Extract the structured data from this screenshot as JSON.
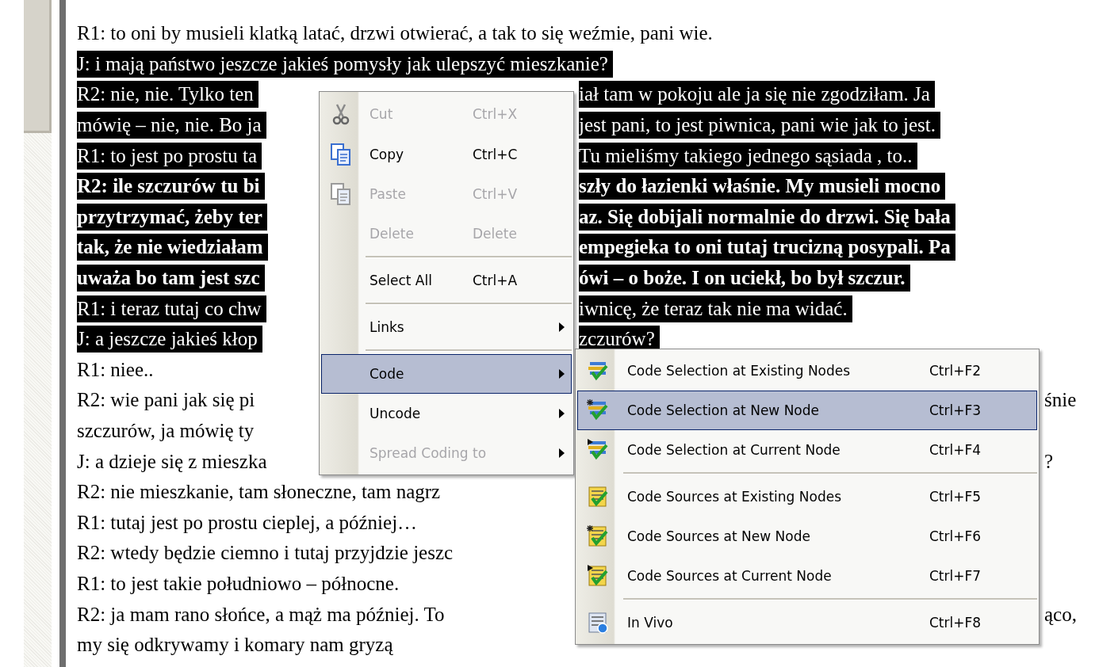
{
  "document": {
    "lines": [
      {
        "left": "R1: to oni by musieli klatką latać, drzwi otwierać, a tak to się weźmie, pani wie.",
        "selected": false,
        "bold": false
      },
      {
        "left": "J: i mają państwo jeszcze jakieś pomysły jak ulepszyć mieszkanie?",
        "selected": true,
        "bold": false
      },
      {
        "left": "R2: nie, nie. Tylko ten",
        "right": "iał tam w pokoju ale ja się nie zgodziłam. Ja",
        "selected": true,
        "bold": false
      },
      {
        "left": "mówię – nie, nie. Bo ja",
        "right": "jest pani, to jest piwnica, pani wie jak to jest.",
        "selected": true,
        "bold": false
      },
      {
        "left": "R1: to jest po prostu ta",
        "right": "Tu mieliśmy takiego jednego sąsiada , to..",
        "selected": true,
        "bold": false
      },
      {
        "left": "R2: ile szczurów tu bi",
        "right": "szły do łazienki właśnie. My musieli mocno",
        "selected": true,
        "bold": true
      },
      {
        "left": "przytrzymać, żeby ter",
        "right": "az. Się dobijali normalnie do drzwi. Się bała",
        "selected": true,
        "bold": true
      },
      {
        "left": "tak, że nie wiedziałam",
        "right": "empegieka to oni tutaj trucizną posypali. Pa",
        "selected": true,
        "bold": true
      },
      {
        "left": "uważa bo tam jest szc",
        "right": "ówi – o boże. I on uciekł, bo był szczur.",
        "selected": true,
        "bold": true
      },
      {
        "left": "R1: i teraz tutaj co chw",
        "right": "iwnicę, że teraz tak nie ma widać.",
        "selected": true,
        "bold": false
      },
      {
        "left": "J: a jeszcze jakieś kłop",
        "right": "zczurów?",
        "selected": true,
        "bold": false
      },
      {
        "left": "R1: niee..",
        "selected": false,
        "bold": false
      },
      {
        "left": "R2: wie pani jak się pi",
        "right": "śnie",
        "selected": false,
        "bold": false
      },
      {
        "left": "szczurów, ja mówię ty",
        "selected": false,
        "bold": false
      },
      {
        "left": "J: a dzieje się z mieszka",
        "right": "?",
        "selected": false,
        "bold": false
      },
      {
        "left": "R2: nie mieszkanie, tam słoneczne, tam nagrz",
        "selected": false,
        "bold": false
      },
      {
        "left": "R1: tutaj jest po prostu cieplej, a później…",
        "selected": false,
        "bold": false
      },
      {
        "left": "R2: wtedy będzie ciemno i tutaj przyjdzie jeszc",
        "selected": false,
        "bold": false
      },
      {
        "left": "R1: to jest takie południowo – północne.",
        "selected": false,
        "bold": false
      },
      {
        "left": "R2: ja mam rano słońce, a mąż ma później. To",
        "right": "ąco,",
        "selected": false,
        "bold": false
      },
      {
        "left": "my się odkrywamy i komary nam gryzą",
        "selected": false,
        "bold": false
      }
    ]
  },
  "context_menu": {
    "items": [
      {
        "kind": "item",
        "label": "Cut",
        "shortcut": "Ctrl+X",
        "disabled": true,
        "selected": false,
        "submenu": false
      },
      {
        "kind": "item",
        "label": "Copy",
        "shortcut": "Ctrl+C",
        "disabled": false,
        "selected": false,
        "submenu": false
      },
      {
        "kind": "item",
        "label": "Paste",
        "shortcut": "Ctrl+V",
        "disabled": true,
        "selected": false,
        "submenu": false
      },
      {
        "kind": "item",
        "label": "Delete",
        "shortcut": "Delete",
        "disabled": true,
        "selected": false,
        "submenu": false
      },
      {
        "kind": "separator"
      },
      {
        "kind": "item",
        "label": "Select All",
        "shortcut": "Ctrl+A",
        "disabled": false,
        "selected": false,
        "submenu": false
      },
      {
        "kind": "separator"
      },
      {
        "kind": "item",
        "label": "Links",
        "disabled": false,
        "selected": false,
        "submenu": true
      },
      {
        "kind": "separator"
      },
      {
        "kind": "item",
        "label": "Code",
        "disabled": false,
        "selected": true,
        "submenu": true
      },
      {
        "kind": "item",
        "label": "Uncode",
        "disabled": false,
        "selected": false,
        "submenu": true
      },
      {
        "kind": "item",
        "label": "Spread Coding to",
        "disabled": true,
        "selected": false,
        "submenu": true
      }
    ]
  },
  "submenu": {
    "items": [
      {
        "kind": "item",
        "label": "Code Selection at Existing Nodes",
        "shortcut": "Ctrl+F2",
        "selected": false
      },
      {
        "kind": "item",
        "label": "Code Selection at New Node",
        "shortcut": "Ctrl+F3",
        "selected": true
      },
      {
        "kind": "item",
        "label": "Code Selection at Current Node",
        "shortcut": "Ctrl+F4",
        "selected": false
      },
      {
        "kind": "separator"
      },
      {
        "kind": "item",
        "label": "Code Sources at Existing Nodes",
        "shortcut": "Ctrl+F5",
        "selected": false
      },
      {
        "kind": "item",
        "label": "Code Sources at New Node",
        "shortcut": "Ctrl+F6",
        "selected": false
      },
      {
        "kind": "item",
        "label": "Code Sources at Current Node",
        "shortcut": "Ctrl+F7",
        "selected": false
      },
      {
        "kind": "separator"
      },
      {
        "kind": "item",
        "label": "In Vivo",
        "shortcut": "Ctrl+F8",
        "selected": false
      }
    ]
  }
}
